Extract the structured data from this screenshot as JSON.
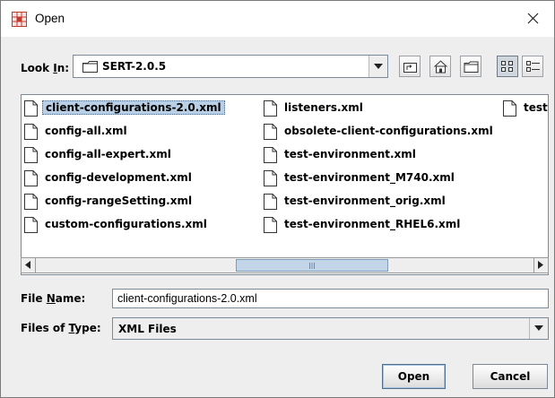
{
  "window": {
    "title": "Open",
    "close_glyph": "×"
  },
  "look_in": {
    "label": "Look In:",
    "label_mnemonic": "I",
    "value": "SERT-2.0.5",
    "toolbar_icons": [
      "up-one-level-icon",
      "home-icon",
      "new-folder-icon",
      "list-view-icon",
      "details-view-icon"
    ],
    "active_view": "list"
  },
  "files": {
    "column1": [
      "client-configurations-2.0.xml",
      "config-all.xml",
      "config-all-expert.xml",
      "config-development.xml",
      "config-rangeSetting.xml",
      "custom-configurations.xml"
    ],
    "column2": [
      "listeners.xml",
      "obsolete-client-configurations.xml",
      "test-environment.xml",
      "test-environment_M740.xml",
      "test-environment_orig.xml",
      "test-environment_RHEL6.xml"
    ],
    "column3": [
      "test"
    ],
    "selected": "client-configurations-2.0.xml"
  },
  "file_name": {
    "label": "File Name:",
    "value": "client-configurations-2.0.xml"
  },
  "file_type": {
    "label": "Files of Type:",
    "value": "XML Files"
  },
  "buttons": {
    "open": "Open",
    "cancel": "Cancel"
  },
  "colors": {
    "selection": "#b8cfe5",
    "panel_bg": "#eeeeee",
    "scroll_thumb": "#c3d5e8"
  }
}
